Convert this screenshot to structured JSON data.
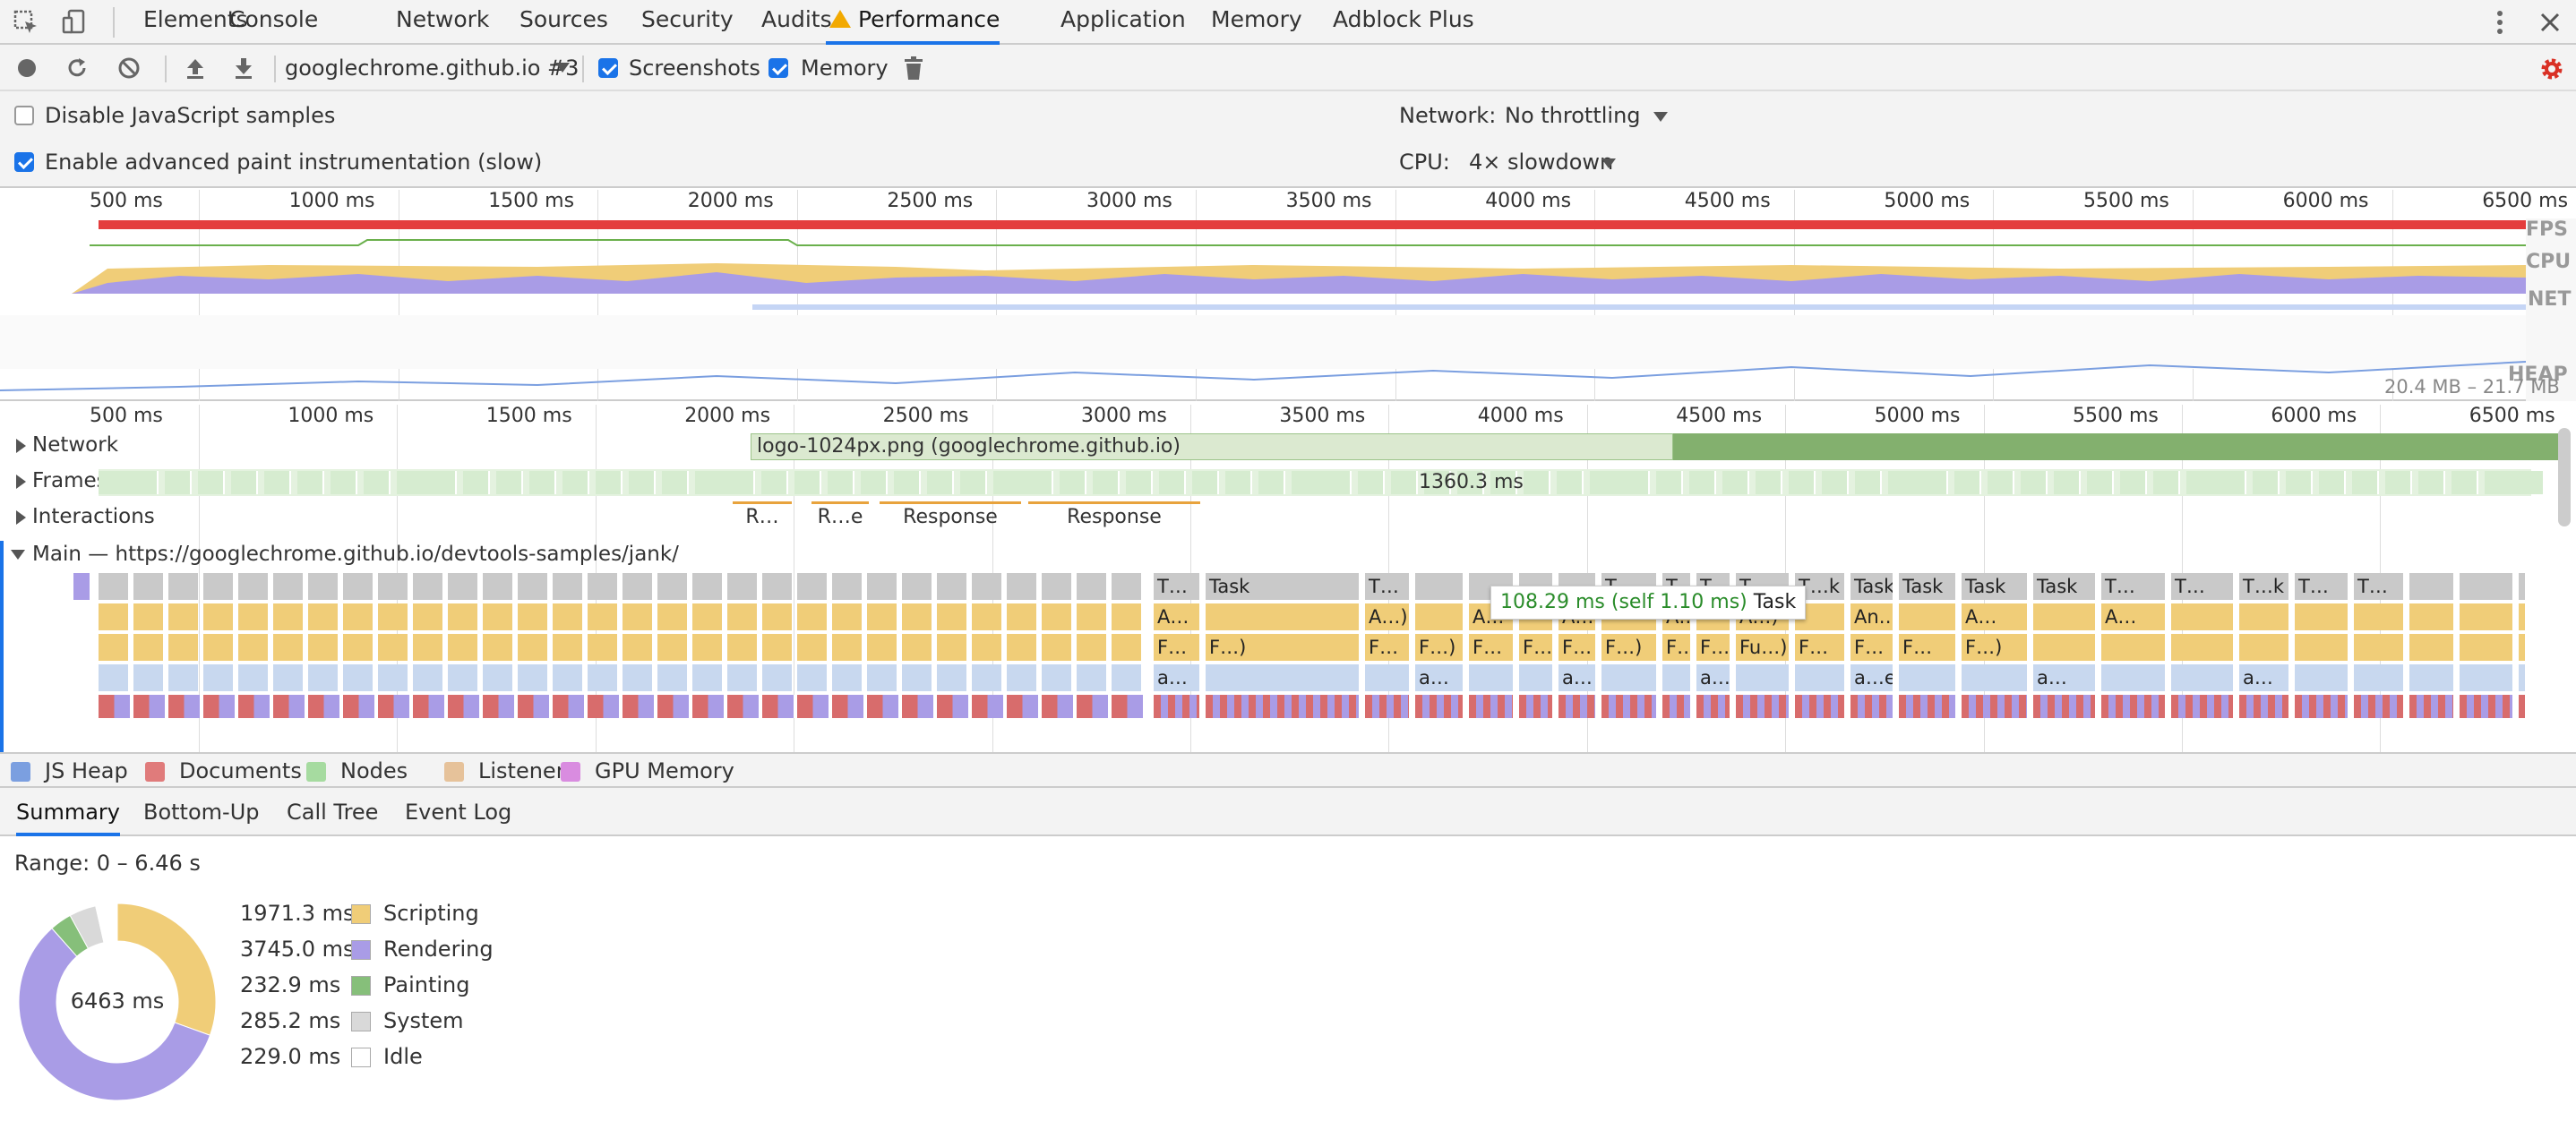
{
  "tabs": [
    "Elements",
    "Console",
    "Network",
    "Sources",
    "Security",
    "Audits",
    "Performance",
    "Application",
    "Memory",
    "Adblock Plus"
  ],
  "selected_tab": "Performance",
  "toolbar": {
    "recording_select": "googlechrome.github.io #3",
    "screenshots_label": "Screenshots",
    "memory_label": "Memory"
  },
  "settings": {
    "disable_js_samples": "Disable JavaScript samples",
    "advanced_paint": "Enable advanced paint instrumentation (slow)",
    "network_label": "Network:",
    "network_value": "No throttling",
    "cpu_label": "CPU:",
    "cpu_value": "4× slowdown"
  },
  "overview": {
    "ticks": [
      "500 ms",
      "1000 ms",
      "1500 ms",
      "2000 ms",
      "2500 ms",
      "3000 ms",
      "3500 ms",
      "4000 ms",
      "4500 ms",
      "5000 ms",
      "5500 ms",
      "6000 ms",
      "6500 ms"
    ],
    "labels": {
      "fps": "FPS",
      "cpu": "CPU",
      "net": "NET",
      "heap": "HEAP"
    },
    "heap_range": "20.4 MB – 21.7 MB"
  },
  "flame": {
    "ticks": [
      "500 ms",
      "1000 ms",
      "1500 ms",
      "2000 ms",
      "2500 ms",
      "3000 ms",
      "3500 ms",
      "4000 ms",
      "4500 ms",
      "5000 ms",
      "5500 ms",
      "6000 ms",
      "6500 ms"
    ],
    "network_label": "Network",
    "network_item": "logo-1024px.png (googlechrome.github.io)",
    "frames_label": "Frames",
    "frames_value": "1360.3 ms",
    "interactions_label": "Interactions",
    "interactions": [
      "R…",
      "R…e",
      "Response",
      "Response"
    ],
    "main_label": "Main — https://googlechrome.github.io/devtools-samples/jank/",
    "tooltip_time": "108.29 ms (self 1.10 ms)",
    "tooltip_name": "Task",
    "task_labels": [
      "T…",
      "Task",
      "T…",
      "T…",
      "T…",
      "T…",
      "T…",
      "T…k",
      "Task",
      "Task",
      "Task",
      "Task",
      "T…",
      "T…",
      "T…k",
      "T…",
      "T…"
    ],
    "row2_labels": [
      "A…",
      "A…)",
      "A…",
      "A…)",
      "A…)",
      "A…)",
      "An…)",
      "A…",
      "A…"
    ],
    "row3_labels": [
      "F…",
      "F…)",
      "F…",
      "F…)",
      "F…",
      "F…",
      "F…",
      "F…)",
      "F…)",
      "F…)",
      "Fu…)",
      "F…",
      "F…",
      "F…",
      "F…)"
    ],
    "row4_labels": [
      "a…",
      "a…",
      "a…",
      "a…e",
      "a…e",
      "a…",
      "a…"
    ]
  },
  "legend": [
    {
      "label": "JS Heap",
      "color": "#7b9fe0"
    },
    {
      "label": "Documents",
      "color": "#e07b7b"
    },
    {
      "label": "Nodes",
      "color": "#a6dba0"
    },
    {
      "label": "Listeners",
      "color": "#e6c29a"
    },
    {
      "label": "GPU Memory",
      "color": "#d98ce0"
    }
  ],
  "bottom_tabs": [
    "Summary",
    "Bottom-Up",
    "Call Tree",
    "Event Log"
  ],
  "summary": {
    "range": "Range: 0 – 6.46 s",
    "total": "6463 ms",
    "rows": [
      {
        "value": "1971.3 ms",
        "label": "Scripting",
        "color": "#f0cd78",
        "ms": 1971.3
      },
      {
        "value": "3745.0 ms",
        "label": "Rendering",
        "color": "#a99ce6",
        "ms": 3745.0
      },
      {
        "value": "232.9 ms",
        "label": "Painting",
        "color": "#86bf7a",
        "ms": 232.9
      },
      {
        "value": "285.2 ms",
        "label": "System",
        "color": "#d9d9d9",
        "ms": 285.2
      },
      {
        "value": "229.0 ms",
        "label": "Idle",
        "color": "#ffffff",
        "ms": 229.0
      }
    ]
  }
}
